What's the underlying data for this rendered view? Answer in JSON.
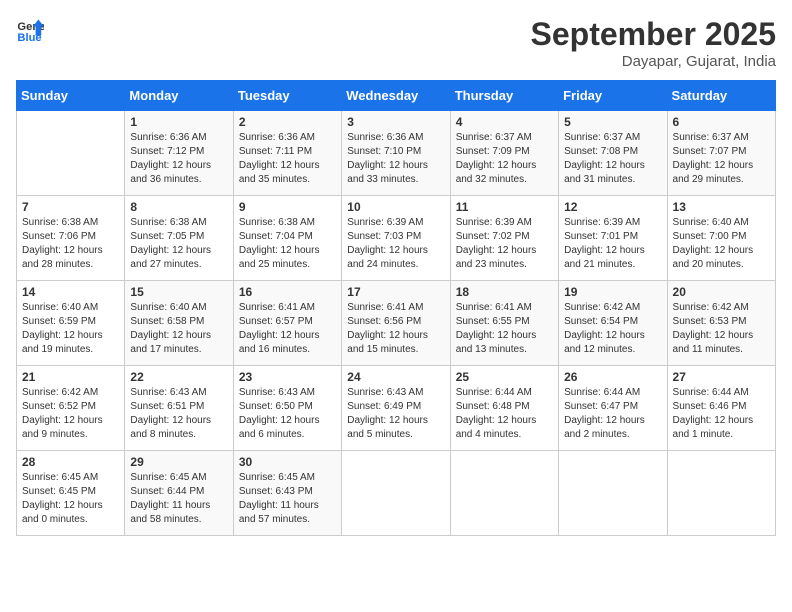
{
  "header": {
    "logo_line1": "General",
    "logo_line2": "Blue",
    "title": "September 2025",
    "subtitle": "Dayapar, Gujarat, India"
  },
  "weekdays": [
    "Sunday",
    "Monday",
    "Tuesday",
    "Wednesday",
    "Thursday",
    "Friday",
    "Saturday"
  ],
  "weeks": [
    [
      {
        "day": "",
        "sunrise": "",
        "sunset": "",
        "daylight": ""
      },
      {
        "day": "1",
        "sunrise": "Sunrise: 6:36 AM",
        "sunset": "Sunset: 7:12 PM",
        "daylight": "Daylight: 12 hours and 36 minutes."
      },
      {
        "day": "2",
        "sunrise": "Sunrise: 6:36 AM",
        "sunset": "Sunset: 7:11 PM",
        "daylight": "Daylight: 12 hours and 35 minutes."
      },
      {
        "day": "3",
        "sunrise": "Sunrise: 6:36 AM",
        "sunset": "Sunset: 7:10 PM",
        "daylight": "Daylight: 12 hours and 33 minutes."
      },
      {
        "day": "4",
        "sunrise": "Sunrise: 6:37 AM",
        "sunset": "Sunset: 7:09 PM",
        "daylight": "Daylight: 12 hours and 32 minutes."
      },
      {
        "day": "5",
        "sunrise": "Sunrise: 6:37 AM",
        "sunset": "Sunset: 7:08 PM",
        "daylight": "Daylight: 12 hours and 31 minutes."
      },
      {
        "day": "6",
        "sunrise": "Sunrise: 6:37 AM",
        "sunset": "Sunset: 7:07 PM",
        "daylight": "Daylight: 12 hours and 29 minutes."
      }
    ],
    [
      {
        "day": "7",
        "sunrise": "Sunrise: 6:38 AM",
        "sunset": "Sunset: 7:06 PM",
        "daylight": "Daylight: 12 hours and 28 minutes."
      },
      {
        "day": "8",
        "sunrise": "Sunrise: 6:38 AM",
        "sunset": "Sunset: 7:05 PM",
        "daylight": "Daylight: 12 hours and 27 minutes."
      },
      {
        "day": "9",
        "sunrise": "Sunrise: 6:38 AM",
        "sunset": "Sunset: 7:04 PM",
        "daylight": "Daylight: 12 hours and 25 minutes."
      },
      {
        "day": "10",
        "sunrise": "Sunrise: 6:39 AM",
        "sunset": "Sunset: 7:03 PM",
        "daylight": "Daylight: 12 hours and 24 minutes."
      },
      {
        "day": "11",
        "sunrise": "Sunrise: 6:39 AM",
        "sunset": "Sunset: 7:02 PM",
        "daylight": "Daylight: 12 hours and 23 minutes."
      },
      {
        "day": "12",
        "sunrise": "Sunrise: 6:39 AM",
        "sunset": "Sunset: 7:01 PM",
        "daylight": "Daylight: 12 hours and 21 minutes."
      },
      {
        "day": "13",
        "sunrise": "Sunrise: 6:40 AM",
        "sunset": "Sunset: 7:00 PM",
        "daylight": "Daylight: 12 hours and 20 minutes."
      }
    ],
    [
      {
        "day": "14",
        "sunrise": "Sunrise: 6:40 AM",
        "sunset": "Sunset: 6:59 PM",
        "daylight": "Daylight: 12 hours and 19 minutes."
      },
      {
        "day": "15",
        "sunrise": "Sunrise: 6:40 AM",
        "sunset": "Sunset: 6:58 PM",
        "daylight": "Daylight: 12 hours and 17 minutes."
      },
      {
        "day": "16",
        "sunrise": "Sunrise: 6:41 AM",
        "sunset": "Sunset: 6:57 PM",
        "daylight": "Daylight: 12 hours and 16 minutes."
      },
      {
        "day": "17",
        "sunrise": "Sunrise: 6:41 AM",
        "sunset": "Sunset: 6:56 PM",
        "daylight": "Daylight: 12 hours and 15 minutes."
      },
      {
        "day": "18",
        "sunrise": "Sunrise: 6:41 AM",
        "sunset": "Sunset: 6:55 PM",
        "daylight": "Daylight: 12 hours and 13 minutes."
      },
      {
        "day": "19",
        "sunrise": "Sunrise: 6:42 AM",
        "sunset": "Sunset: 6:54 PM",
        "daylight": "Daylight: 12 hours and 12 minutes."
      },
      {
        "day": "20",
        "sunrise": "Sunrise: 6:42 AM",
        "sunset": "Sunset: 6:53 PM",
        "daylight": "Daylight: 12 hours and 11 minutes."
      }
    ],
    [
      {
        "day": "21",
        "sunrise": "Sunrise: 6:42 AM",
        "sunset": "Sunset: 6:52 PM",
        "daylight": "Daylight: 12 hours and 9 minutes."
      },
      {
        "day": "22",
        "sunrise": "Sunrise: 6:43 AM",
        "sunset": "Sunset: 6:51 PM",
        "daylight": "Daylight: 12 hours and 8 minutes."
      },
      {
        "day": "23",
        "sunrise": "Sunrise: 6:43 AM",
        "sunset": "Sunset: 6:50 PM",
        "daylight": "Daylight: 12 hours and 6 minutes."
      },
      {
        "day": "24",
        "sunrise": "Sunrise: 6:43 AM",
        "sunset": "Sunset: 6:49 PM",
        "daylight": "Daylight: 12 hours and 5 minutes."
      },
      {
        "day": "25",
        "sunrise": "Sunrise: 6:44 AM",
        "sunset": "Sunset: 6:48 PM",
        "daylight": "Daylight: 12 hours and 4 minutes."
      },
      {
        "day": "26",
        "sunrise": "Sunrise: 6:44 AM",
        "sunset": "Sunset: 6:47 PM",
        "daylight": "Daylight: 12 hours and 2 minutes."
      },
      {
        "day": "27",
        "sunrise": "Sunrise: 6:44 AM",
        "sunset": "Sunset: 6:46 PM",
        "daylight": "Daylight: 12 hours and 1 minute."
      }
    ],
    [
      {
        "day": "28",
        "sunrise": "Sunrise: 6:45 AM",
        "sunset": "Sunset: 6:45 PM",
        "daylight": "Daylight: 12 hours and 0 minutes."
      },
      {
        "day": "29",
        "sunrise": "Sunrise: 6:45 AM",
        "sunset": "Sunset: 6:44 PM",
        "daylight": "Daylight: 11 hours and 58 minutes."
      },
      {
        "day": "30",
        "sunrise": "Sunrise: 6:45 AM",
        "sunset": "Sunset: 6:43 PM",
        "daylight": "Daylight: 11 hours and 57 minutes."
      },
      {
        "day": "",
        "sunrise": "",
        "sunset": "",
        "daylight": ""
      },
      {
        "day": "",
        "sunrise": "",
        "sunset": "",
        "daylight": ""
      },
      {
        "day": "",
        "sunrise": "",
        "sunset": "",
        "daylight": ""
      },
      {
        "day": "",
        "sunrise": "",
        "sunset": "",
        "daylight": ""
      }
    ]
  ]
}
